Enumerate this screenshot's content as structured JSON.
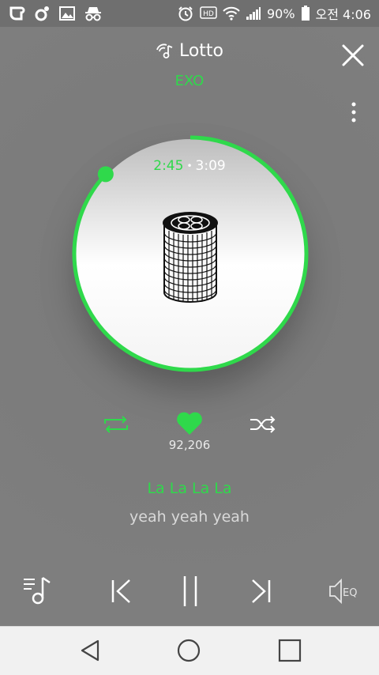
{
  "status_bar": {
    "left_icons": [
      "onestore-icon",
      "music-app-icon",
      "gallery-icon",
      "incognito-icon"
    ],
    "right_icons": [
      "alarm-icon",
      "hd-voice-icon",
      "wifi-icon",
      "signal-icon",
      "battery-icon"
    ],
    "hd_label": "HD",
    "battery_percent": "90%",
    "time": "오전 4:06"
  },
  "player": {
    "title": "Lotto",
    "artist": "EXO",
    "current_time": "2:45",
    "separator": "•",
    "total_time": "3:09",
    "progress": 0.87,
    "likes": "92,206",
    "lyric_current": "La La La La",
    "lyric_next": "yeah yeah yeah",
    "eq_label": "EQ"
  },
  "colors": {
    "accent": "#2fd94b",
    "background": "#7d7d7d",
    "navbar": "#f1f1f1"
  },
  "icons": {
    "title": "music-note-icon",
    "close": "close-icon",
    "more": "more-vertical-icon",
    "repeat": "repeat-icon",
    "like": "heart-icon",
    "shuffle": "shuffle-icon",
    "playlist": "playlist-icon",
    "previous": "skip-previous-icon",
    "pause": "pause-icon",
    "next": "skip-next-icon",
    "equalizer": "equalizer-icon"
  }
}
